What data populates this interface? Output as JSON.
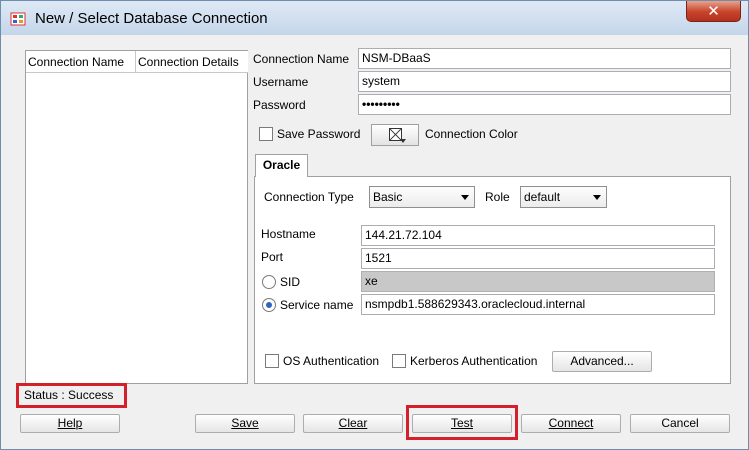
{
  "window": {
    "title": "New / Select Database Connection",
    "close_glyph": "✕"
  },
  "list": {
    "col_name": "Connection Name",
    "col_details": "Connection Details"
  },
  "form": {
    "connection_name_label": "Connection Name",
    "connection_name_value": "NSM-DBaaS",
    "username_label": "Username",
    "username_value": "system",
    "password_label": "Password",
    "password_value": "•••••••••",
    "save_password_label": "Save Password",
    "connection_color_label": "Connection Color"
  },
  "tab": {
    "label": "Oracle"
  },
  "oracle": {
    "connection_type_label": "Connection Type",
    "connection_type_value": "Basic",
    "role_label": "Role",
    "role_value": "default",
    "hostname_label": "Hostname",
    "hostname_value": "144.21.72.104",
    "port_label": "Port",
    "port_value": "1521",
    "sid_label": "SID",
    "sid_value": "xe",
    "service_name_label": "Service name",
    "service_name_value": "nsmpdb1.588629343.oraclecloud.internal",
    "os_auth_label": "OS Authentication",
    "kerberos_label": "Kerberos Authentication",
    "advanced_label": "Advanced..."
  },
  "status": {
    "text": "Status : Success"
  },
  "buttons": {
    "help": "Help",
    "save": "Save",
    "clear": "Clear",
    "test": "Test",
    "connect": "Connect",
    "cancel": "Cancel"
  },
  "colors": {
    "highlight": "#d4202b",
    "radio_selected": "#2f63c2"
  }
}
